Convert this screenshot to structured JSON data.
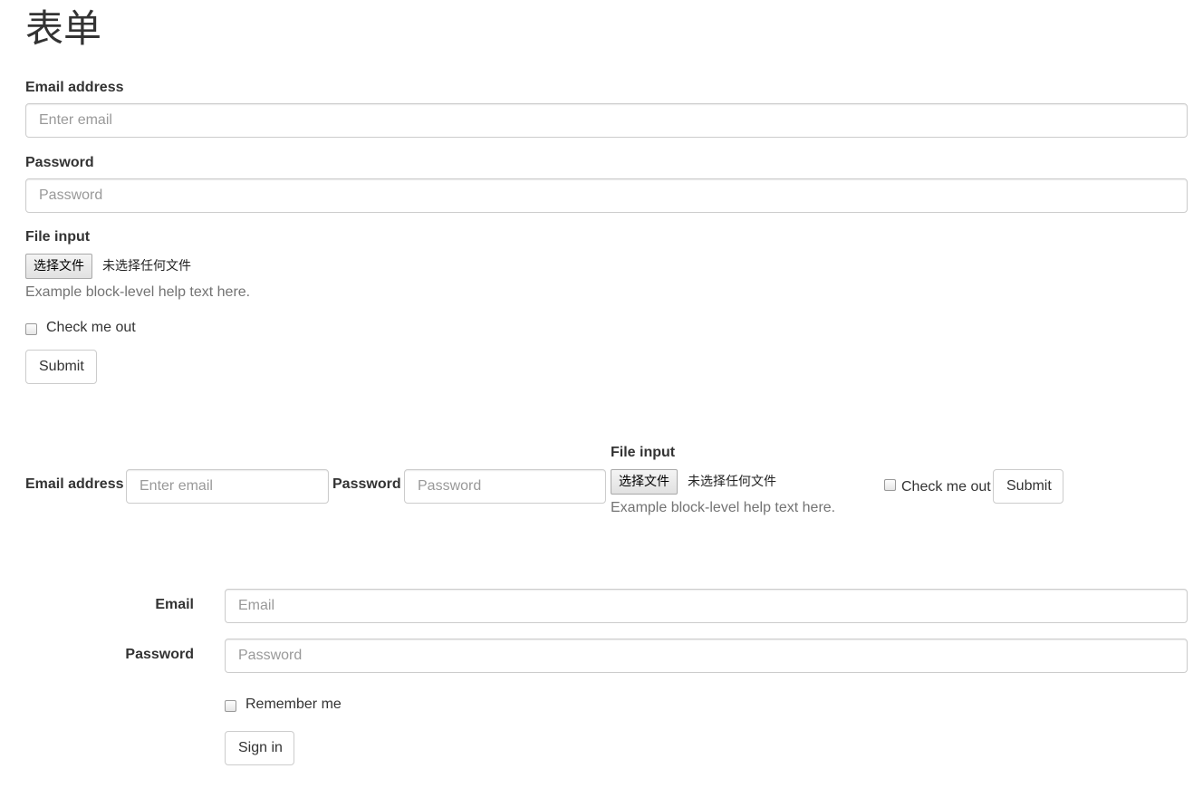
{
  "page": {
    "title": "表单"
  },
  "basic_form": {
    "email_label": "Email address",
    "email_placeholder": "Enter email",
    "password_label": "Password",
    "password_placeholder": "Password",
    "file_label": "File input",
    "file_button": "选择文件",
    "file_status": "未选择任何文件",
    "help_text": "Example block-level help text here.",
    "check_label": "Check me out",
    "submit_label": "Submit"
  },
  "inline_form": {
    "email_label": "Email address",
    "email_placeholder": "Enter email",
    "password_label": "Password",
    "password_placeholder": "Password",
    "file_label": "File input",
    "file_button": "选择文件",
    "file_status": "未选择任何文件",
    "help_text": "Example block-level help text here.",
    "check_label": "Check me out",
    "submit_label": "Submit"
  },
  "horizontal_form": {
    "email_label": "Email",
    "email_placeholder": "Email",
    "password_label": "Password",
    "password_placeholder": "Password",
    "remember_label": "Remember me",
    "signin_label": "Sign in"
  }
}
